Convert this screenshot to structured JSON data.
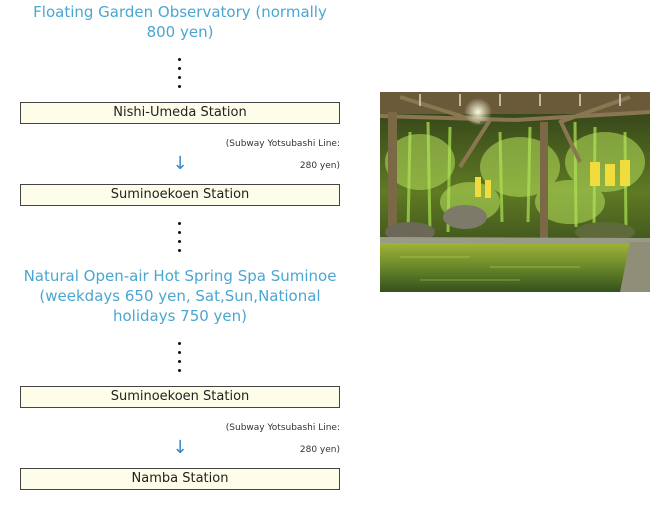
{
  "route": {
    "dest1": "Floating Garden Observatory (normally 800 yen)",
    "station1": "Nishi-Umeda Station",
    "fare1_line": "(Subway Yotsubashi Line:",
    "fare1_price": "280 yen)",
    "station2": "Suminoekoen Station",
    "dest2": "Natural Open-air Hot Spring Spa Suminoe (weekdays 650 yen, Sat,Sun,National holidays 750 yen)",
    "station3": "Suminoekoen Station",
    "fare2_line": "(Subway Yotsubashi Line:",
    "fare2_price": "280 yen)",
    "station4": "Namba Station",
    "arrow_glyph": "↓"
  },
  "photo": {
    "icon": "open-air-hot-spring-photo"
  },
  "colors": {
    "destination_text": "#4aa6d2",
    "station_box_bg": "#fefde9",
    "arrow": "#3a87c8"
  }
}
